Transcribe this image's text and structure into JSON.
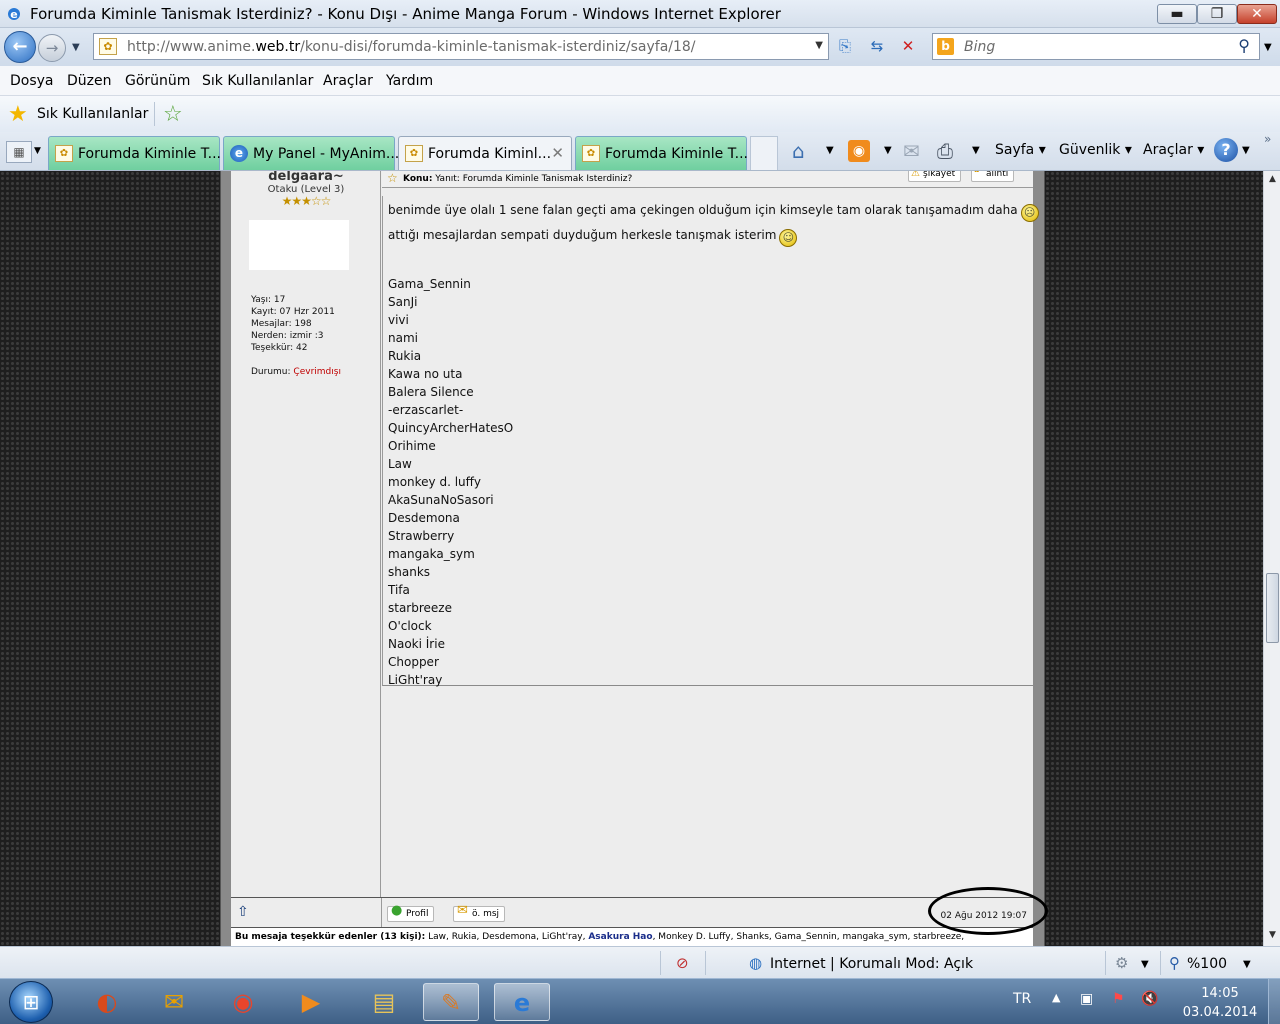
{
  "window": {
    "title": "Forumda Kiminle Tanismak Isterdiniz? - Konu Dışı - Anime Manga Forum - Windows Internet Explorer"
  },
  "address": {
    "url_prefix": "http://www.anime.",
    "url_domain": "web.tr",
    "url_path": "/konu-disi/forumda-kiminle-tanismak-isterdiniz/sayfa/18/"
  },
  "search": {
    "placeholder": "Bing"
  },
  "menu": [
    "Dosya",
    "Düzen",
    "Görünüm",
    "Sık Kullanılanlar",
    "Araçlar",
    "Yardım"
  ],
  "favorites": {
    "label": "Sık Kullanılanlar"
  },
  "tabs": [
    {
      "label": "Forumda Kiminle T..."
    },
    {
      "label": "My Panel - MyAnim..."
    },
    {
      "label": "Forumda Kiminl..."
    },
    {
      "label": "Forumda Kiminle T..."
    }
  ],
  "commandbar": {
    "page": "Sayfa",
    "safety": "Güvenlik",
    "tools": "Araçlar",
    "help": "?"
  },
  "post": {
    "username": "delgaara~",
    "rank": "Otaku (Level 3)",
    "stars": "★★★☆☆",
    "stats": [
      {
        "label": "Yaşı:",
        "value": "17"
      },
      {
        "label": "Kayıt:",
        "value": "07 Hzr 2011"
      },
      {
        "label": "Mesajlar:",
        "value": "198"
      },
      {
        "label": "Nerden:",
        "value": "izmir :3"
      },
      {
        "label": "Teşekkür:",
        "value": "42"
      }
    ],
    "status_label": "Durumu:",
    "status_value": "Çevrimdışı",
    "subject_label": "Konu:",
    "subject_value": "Yanıt: Forumda Kiminle Tanismak Isterdiniz?",
    "report_button": "şikayet",
    "quote_button": "alıntı",
    "message_line1": "benimde üye olalı 1 sene falan geçti ama çekingen olduğum için kimseyle tam olarak tanışamadım daha",
    "message_line2": "attığı mesajlardan sempati duyduğum herkesle tanışmak isterim",
    "names": [
      "Gama_Sennin",
      "SanJi",
      "vivi",
      "nami",
      "Rukia",
      "Kawa no uta",
      "Balera Silence",
      "-erzascarlet-",
      "QuincyArcherHatesO",
      "Orihime",
      "Law",
      "monkey d. luffy",
      "AkaSunaNoSasori",
      "Desdemona",
      "Strawberry",
      "mangaka_sym",
      "shanks",
      "Tifa",
      "starbreeze",
      "O'clock",
      "Naoki İrie",
      "Chopper",
      "LiGht'ray"
    ],
    "profile_button": "Profil",
    "pm_button": "ö. msj",
    "date": "02 Ağu 2012 19:07",
    "thanks_label": "Bu mesaja teşekkür edenler (13 kişi):",
    "thanks_pre": "Law, Rukia, Desdemona, LiGht'ray,",
    "thanks_highlight": "Asakura Hao",
    "thanks_post": ", Monkey D. Luffy, Shanks, Gama_Sennin, mangaka_sym, starbreeze,"
  },
  "statusbar": {
    "zone": "Internet | Korumalı Mod: Açık",
    "zoom": "%100"
  },
  "taskbar": {
    "lang": "TR",
    "time": "14:05",
    "date": "03.04.2014"
  }
}
